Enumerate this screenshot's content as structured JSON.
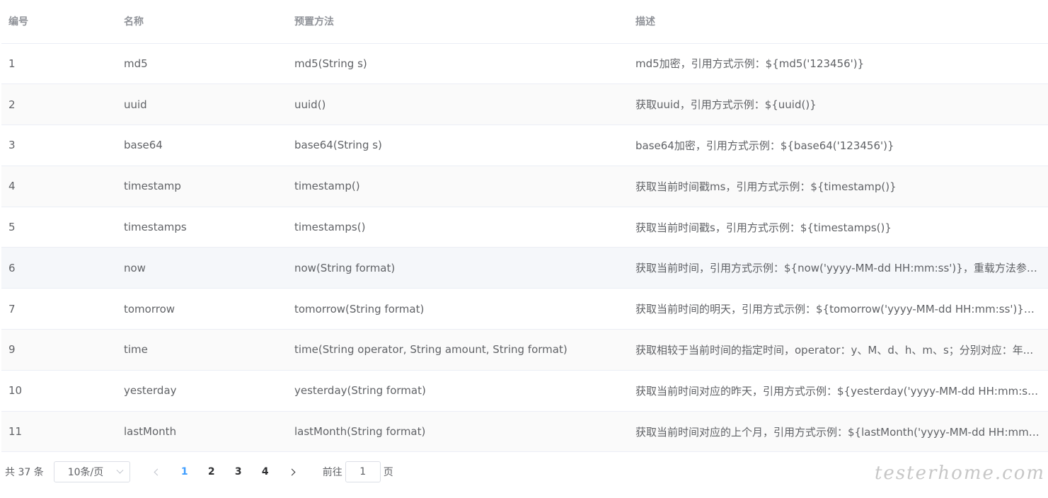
{
  "table": {
    "headers": [
      "编号",
      "名称",
      "预置方法",
      "描述"
    ],
    "rows": [
      {
        "id": "1",
        "name": "md5",
        "method": "md5(String s)",
        "desc": "md5加密，引用方式示例：${md5('123456')}"
      },
      {
        "id": "2",
        "name": "uuid",
        "method": "uuid()",
        "desc": "获取uuid，引用方式示例：${uuid()}"
      },
      {
        "id": "3",
        "name": "base64",
        "method": "base64(String s)",
        "desc": "base64加密，引用方式示例：${base64('123456')}"
      },
      {
        "id": "4",
        "name": "timestamp",
        "method": "timestamp()",
        "desc": "获取当前时间戳ms，引用方式示例：${timestamp()}"
      },
      {
        "id": "5",
        "name": "timestamps",
        "method": "timestamps()",
        "desc": "获取当前时间戳s，引用方式示例：${timestamps()}"
      },
      {
        "id": "6",
        "name": "now",
        "method": "now(String format)",
        "desc": "获取当前时间，引用方式示例：${now('yyyy-MM-dd HH:mm:ss')}，重载方法参数..."
      },
      {
        "id": "7",
        "name": "tomorrow",
        "method": "tomorrow(String format)",
        "desc": "获取当前时间的明天，引用方式示例：${tomorrow('yyyy-MM-dd HH:mm:ss')}，..."
      },
      {
        "id": "9",
        "name": "time",
        "method": "time(String operator, String amount, String format)",
        "desc": "获取相较于当前时间的指定时间，operator：y、M、d、h、m、s；分别对应：年..."
      },
      {
        "id": "10",
        "name": "yesterday",
        "method": "yesterday(String format)",
        "desc": "获取当前时间对应的昨天，引用方式示例：${yesterday('yyyy-MM-dd HH:mm:ss')..."
      },
      {
        "id": "11",
        "name": "lastMonth",
        "method": "lastMonth(String format)",
        "desc": "获取当前时间对应的上个月，引用方式示例：${lastMonth('yyyy-MM-dd HH:mm:..."
      }
    ]
  },
  "pagination": {
    "total_label": "共 37 条",
    "page_size": "10条/页",
    "pages": [
      "1",
      "2",
      "3",
      "4"
    ],
    "current_page": "1",
    "goto_prefix": "前往",
    "goto_value": "1",
    "goto_suffix": "页"
  },
  "watermark": "testerhome.com",
  "colors": {
    "accent": "#409eff",
    "header_text": "#909399",
    "body_text": "#606266",
    "border": "#ebeef5",
    "stripe": "#fafafa",
    "hover": "#f5f7fa"
  }
}
